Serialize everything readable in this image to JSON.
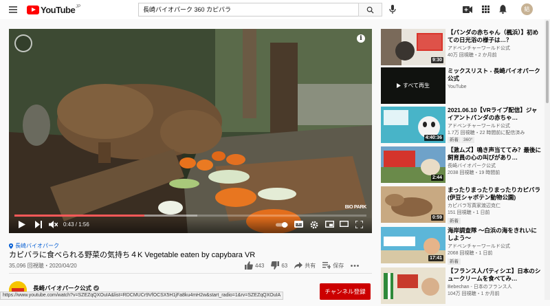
{
  "header": {
    "logo_text": "YouTube",
    "logo_country": "JP",
    "search_value": "長崎バイオパーク 360 カピバラ",
    "avatar_letter": "結"
  },
  "player": {
    "time": "0:43 / 1:56",
    "progress": 0.37,
    "watermark": "BIO PARK"
  },
  "video": {
    "tag": "長崎バイオパーク",
    "title": "カピバラに食べられる野菜の気持ち４K Vegetable eaten by capybara VR",
    "views": "35,096 回視聴・2020/04/20",
    "likes": "443",
    "dislikes": "63",
    "share": "共有",
    "save": "保存"
  },
  "channel": {
    "name": "長崎バイオパーク公式",
    "subscribe": "チャンネル登録"
  },
  "status_url": "https://www.youtube.com/watch?v=SZEZqQXOuIA&list=RDCMUCr9VfOCSX5H1jFa8ku4mH2w&start_radio=1&rv=SZEZqQXOuIA",
  "recommendations": [
    {
      "title": "【パンダの赤ちゃん（楓浜）】初めての日光浴の様子は…？",
      "channel": "アドベンチャーワールド公式",
      "meta": "40万 回視聴・2 か月前",
      "duration": "9:30"
    },
    {
      "title": "ミックスリスト - 長崎バイオパーク公式",
      "channel": "YouTube",
      "meta": "",
      "overlay": "すべて再生"
    },
    {
      "title": "2021.06.10【VRライブ配信】ジャイアントパンダの赤ちゃ…",
      "channel": "アドベンチャーワールド公式",
      "meta": "1.7万 回視聴・22 時間前に配信済み",
      "duration": "4:40:36",
      "badges": [
        "新着",
        "360°"
      ]
    },
    {
      "title": "【激ムズ】鳴き声当ててみ？最後に飼育員の心の叫びがあり…",
      "channel": "長崎バイオパーク公式",
      "meta": "2038 回視聴・19 時間前",
      "duration": "2:44",
      "verified": true
    },
    {
      "title": "まったりまったりまったりカピバラ (伊豆シャボテン動物公園)",
      "channel": "カピバラ写真家渡辺克仁",
      "meta": "151 回視聴・1 日前",
      "duration": "0:59",
      "badges": [
        "新着"
      ]
    },
    {
      "title": "海岸調査隊 ～白浜の海をきれいにしよう～",
      "channel": "アドベンチャーワールド公式",
      "meta": "2068 回視聴・1 日前",
      "duration": "17:41",
      "badges": [
        "新着"
      ]
    },
    {
      "title": "【フランス人パティシエ】日本のシュークリームを食べてみ…",
      "channel": "Bebechan - 日本のフランス人",
      "meta": "104万 回視聴・1 か月前",
      "duration": ""
    }
  ]
}
